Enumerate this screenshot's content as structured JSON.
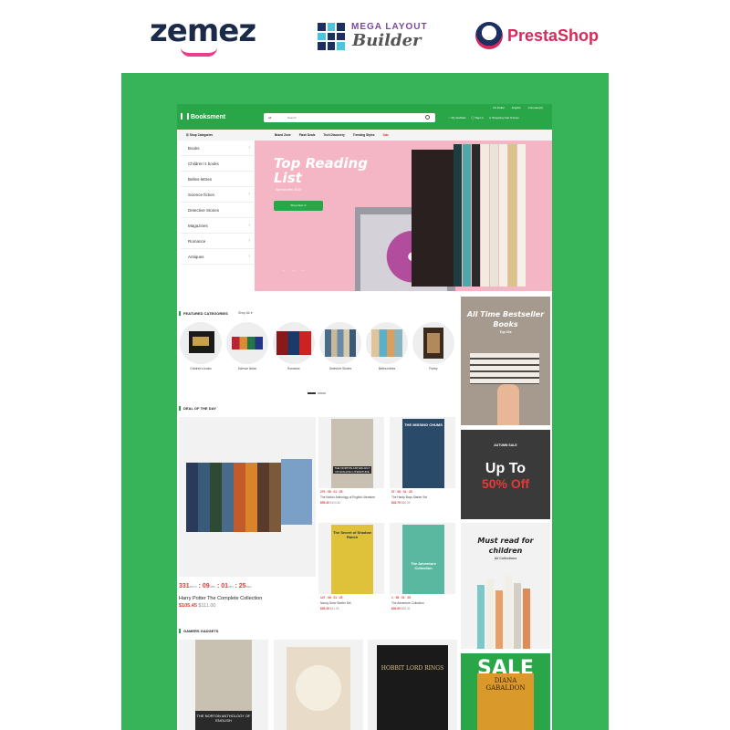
{
  "vendors": {
    "zemez": "zemez",
    "mega_layout_small": "MEGA LAYOUT",
    "mega_layout_big": "Builder",
    "prestashop": "PrestaShop"
  },
  "header": {
    "brand": "Booksment",
    "top_links": [
      "US Dollar",
      "English",
      "Compare(0)"
    ],
    "search_category": "All",
    "search_placeholder": "Search",
    "wishlist": "My wishlists",
    "signin": "Sign in",
    "cart": "Shopping Cart 0 items"
  },
  "nav": {
    "categories_label": "Shop Categories",
    "links": [
      "Brand Zone",
      "Flash Deals",
      "Tech Discovery",
      "Trending Styles"
    ],
    "sale": "Sale"
  },
  "sidebar": {
    "items": [
      {
        "label": "Books",
        "chevron": "›"
      },
      {
        "label": "Children`s books",
        "chevron": ""
      },
      {
        "label": "Belles-lettres",
        "chevron": ""
      },
      {
        "label": "Science fiction",
        "chevron": "›"
      },
      {
        "label": "Detective Stories",
        "chevron": ""
      },
      {
        "label": "Magazines",
        "chevron": "›"
      },
      {
        "label": "Romance",
        "chevron": "›"
      },
      {
        "label": "Antiques",
        "chevron": "›"
      }
    ]
  },
  "hero": {
    "title": "Top Reading List",
    "subtitle": "Special offer 2019",
    "button": "Shop Now  ➜",
    "dots": "— — —"
  },
  "featured": {
    "title": "FEATURED CATEGORIES",
    "shop_all": "Shop All",
    "categories": [
      "Children's books",
      "Science fiction",
      "Romance",
      "Detective Stories",
      "Belles-lettres",
      "Poetry"
    ]
  },
  "deal": {
    "title": "DEAL OF THE DAY",
    "countdown": {
      "days": "331",
      "hours": "09",
      "mins": "01",
      "secs": "25",
      "days_lbl": "DAYS",
      "hours_lbl": "HRS",
      "mins_lbl": "MIN",
      "secs_lbl": "SEC"
    },
    "name": "Harry Potter The Complete Collection",
    "price": "$105.45",
    "old_price": "$111.00",
    "minis": [
      {
        "cd": "270  ·  08  ·  01  ·  25",
        "name": "The Norton Anthology of English Literature",
        "price": "$95.40",
        "old": "$100.40"
      },
      {
        "cd": "97  ·  08  ·  01  ·  25",
        "name": "The Hardy Boys Starter Set",
        "price": "$43.79",
        "old": "$46.09"
      },
      {
        "cd": "147  ·  08  ·  01  ·  25",
        "name": "Nancy Drew Starter Set",
        "price": "$39.26",
        "old": "$41.33"
      },
      {
        "cd": "1  ·  08  ·  01  ·  25",
        "name": "The Adventure Collection",
        "price": "$26.90",
        "old": "$28.32"
      }
    ],
    "mini_titles": [
      "THE NORTON ANTHOLOGY OF ENGLISH LITERATURE",
      "THE MISSING CHUMS",
      "The Secret of Shadow Ranch",
      "The Adventure Collection"
    ]
  },
  "promos": {
    "bestseller_title": "All Time Bestseller Books",
    "bestseller_sub": "Top 10s",
    "autumn_sub": "AUTUMN SALE",
    "autumn_title": "Up To",
    "autumn_percent": "50% Off",
    "read_title": "Must read for children",
    "read_sub": "All Collections",
    "sale_title": "SALE",
    "sale_book": "DIANA GABALDON"
  },
  "gadgets": {
    "title": "GAMERS GADGETS",
    "covers": [
      "THE NORTON ANTHOLOGY OF ENGLISH",
      "",
      "HOBBIT LORD RINGS"
    ]
  },
  "colors": {
    "accent": "#29a748",
    "backdrop": "#37b45a",
    "sale": "#e53935",
    "hero": "#f4b6c4"
  }
}
